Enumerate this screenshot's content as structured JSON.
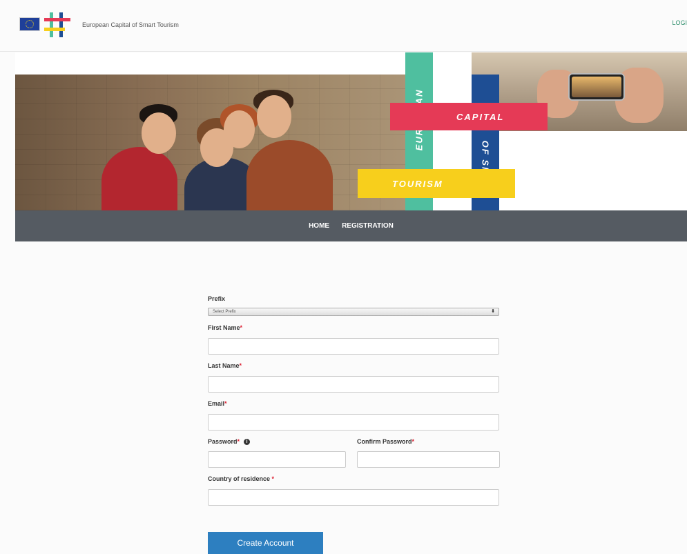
{
  "header": {
    "site_title": "European Capital of Smart Tourism",
    "login_label": "LOGI"
  },
  "hero": {
    "band_green": "EUROPEAN",
    "band_red": "CAPITAL",
    "band_navy": "OF SMART",
    "band_yellow": "TOURISM"
  },
  "nav": {
    "items": [
      {
        "label": "HOME"
      },
      {
        "label": "REGISTRATION"
      }
    ]
  },
  "form": {
    "prefix_label": "Prefix",
    "prefix_value": "Select Prefix",
    "first_name_label": "First Name",
    "last_name_label": "Last Name",
    "email_label": "Email",
    "password_label": "Password",
    "confirm_password_label": "Confirm Password",
    "country_label": "Country of residence ",
    "required_mark": "*",
    "submit_label": "Create Account"
  },
  "icons": {
    "flag": "eu-flag-icon",
    "logo": "smart-tourism-logo-icon",
    "info": "info-icon",
    "select_arrow": "select-arrows-icon"
  },
  "colors": {
    "nav_bg": "#555b62",
    "button": "#2d7fc0",
    "band_green": "#4fbf9f",
    "band_red": "#e53a56",
    "band_navy": "#1e4e94",
    "band_yellow": "#f7cf1c",
    "required": "#dd2233"
  }
}
